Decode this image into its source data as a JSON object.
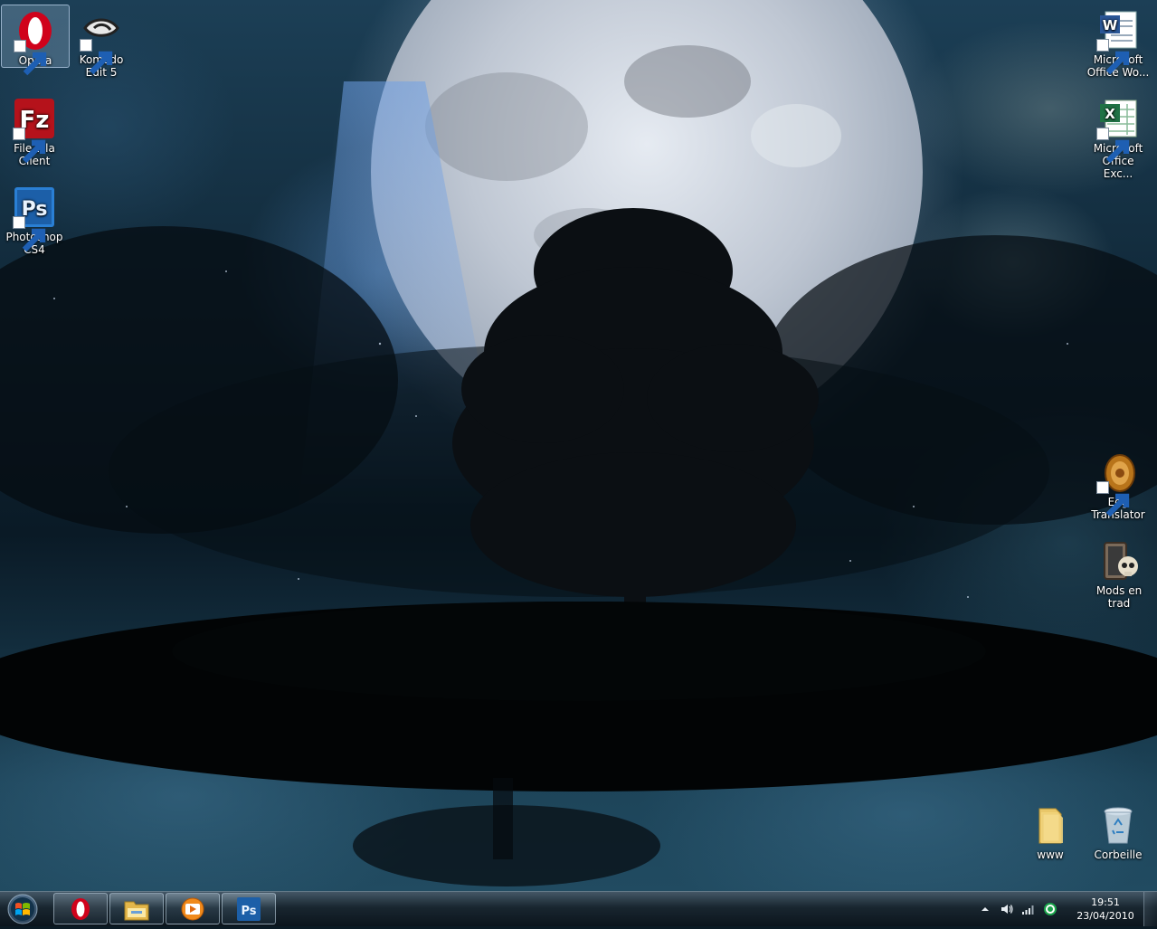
{
  "desktop": {
    "icons": {
      "opera": {
        "label": "Opera"
      },
      "komodo": {
        "label": "Komodo Edit 5"
      },
      "filezilla": {
        "label": "FileZilla Client"
      },
      "photoshop": {
        "label": "Photoshop CS4"
      },
      "word": {
        "label": "Microsoft Office Wo..."
      },
      "excel": {
        "label": "Microsoft Office Exc..."
      },
      "egg": {
        "label": "Egg Translator"
      },
      "mods": {
        "label": "Mods en trad"
      },
      "www": {
        "label": "www"
      },
      "trash": {
        "label": "Corbeille"
      }
    }
  },
  "taskbar": {
    "pinned": [
      "opera-icon",
      "explorer-icon",
      "media-player-icon",
      "photoshop-icon"
    ],
    "tray": {
      "time": "19:51",
      "date": "23/04/2010"
    }
  },
  "colors": {
    "opera_red": "#d0021b",
    "filezilla_red": "#b5121b",
    "photoshop_blue": "#2a7fd4",
    "word_blue": "#2b5797",
    "excel_green": "#207245"
  }
}
